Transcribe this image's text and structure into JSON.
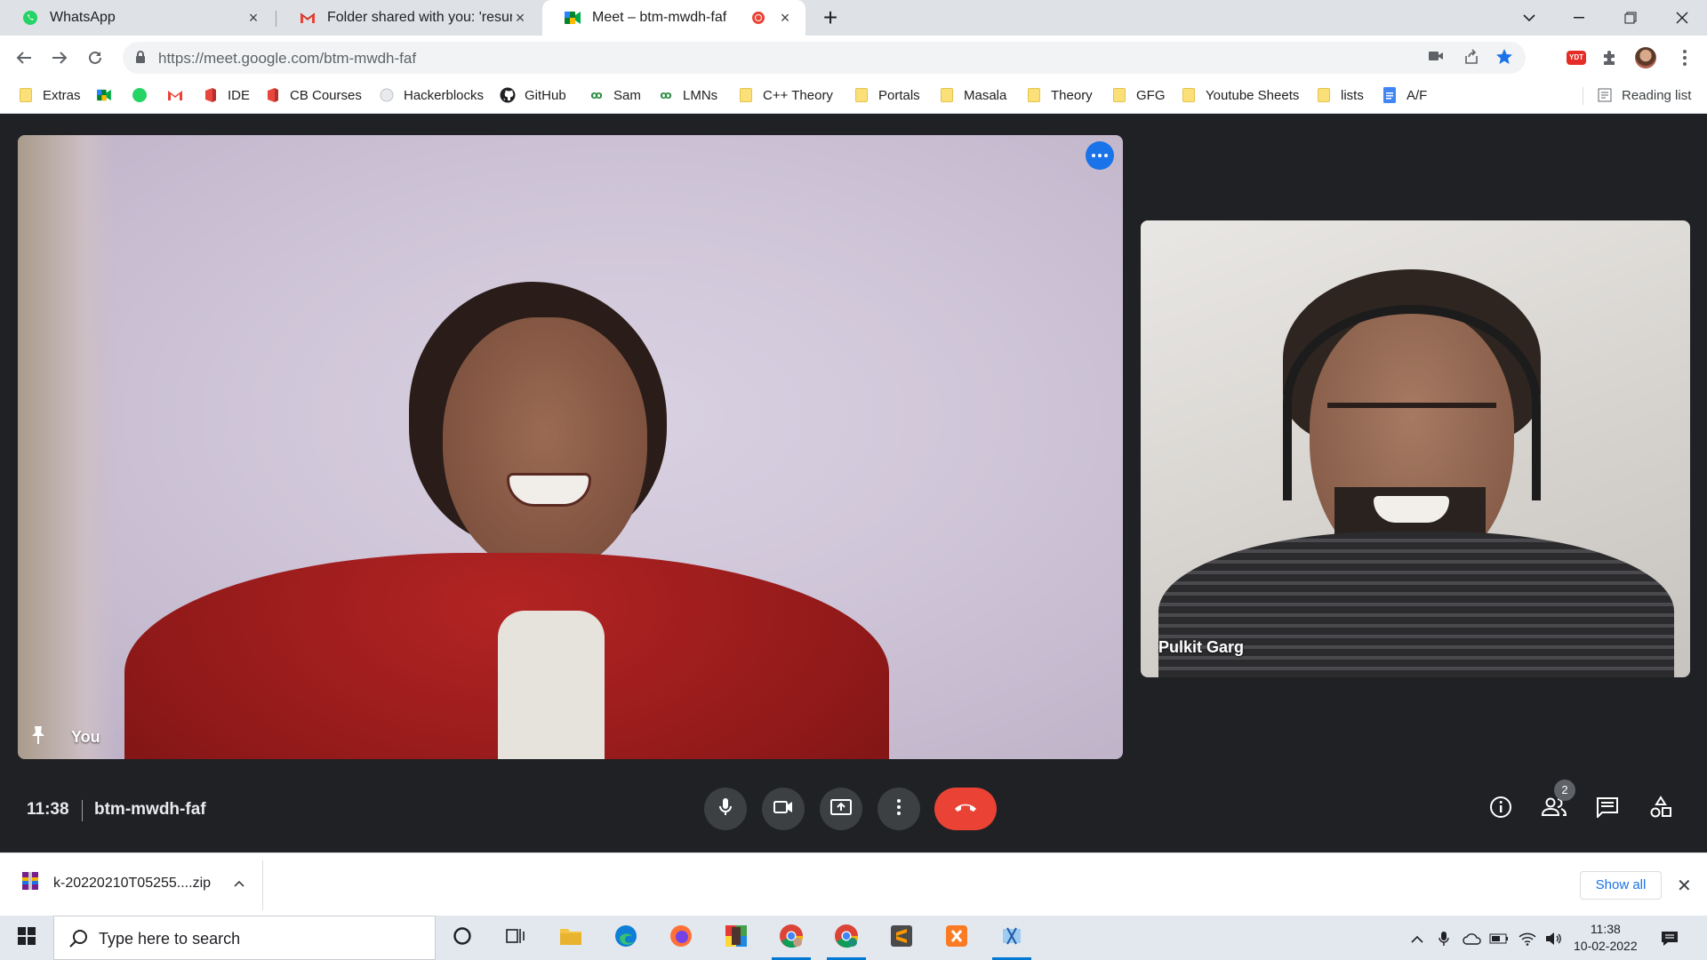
{
  "browser": {
    "tabs": [
      {
        "title": "WhatsApp",
        "icon": "whatsapp-icon"
      },
      {
        "title": "Folder shared with you: 'resume",
        "icon": "gmail-icon"
      },
      {
        "title": "Meet – btm-mwdh-faf",
        "icon": "google-meet-icon"
      }
    ],
    "address_bar": {
      "url": "https://meet.google.com/btm-mwdh-faf"
    },
    "bookmarks": [
      "Extras",
      "IDE",
      "CB Courses",
      "Hackerblocks",
      "GitHub",
      "Sam",
      "LMNs",
      "C++ Theory",
      "Portals",
      "Masala",
      "Theory",
      "GFG",
      "Youtube Sheets",
      "lists",
      "A/F"
    ],
    "reading_list": "Reading list",
    "extension_badge": "YDT"
  },
  "meet": {
    "main_participant": "You",
    "side_participant": "Pulkit Garg",
    "time": "11:38",
    "meeting_code": "btm-mwdh-faf",
    "participants_count": "2"
  },
  "downloads": {
    "file_name": "k-20220210T05255....zip",
    "show_all": "Show all"
  },
  "taskbar": {
    "search_placeholder": "Type here to search",
    "time": "11:38",
    "date": "10-02-2022"
  },
  "colors": {
    "end_call": "#ea4335",
    "meet_bg": "#202124",
    "accent": "#1a73e8"
  }
}
